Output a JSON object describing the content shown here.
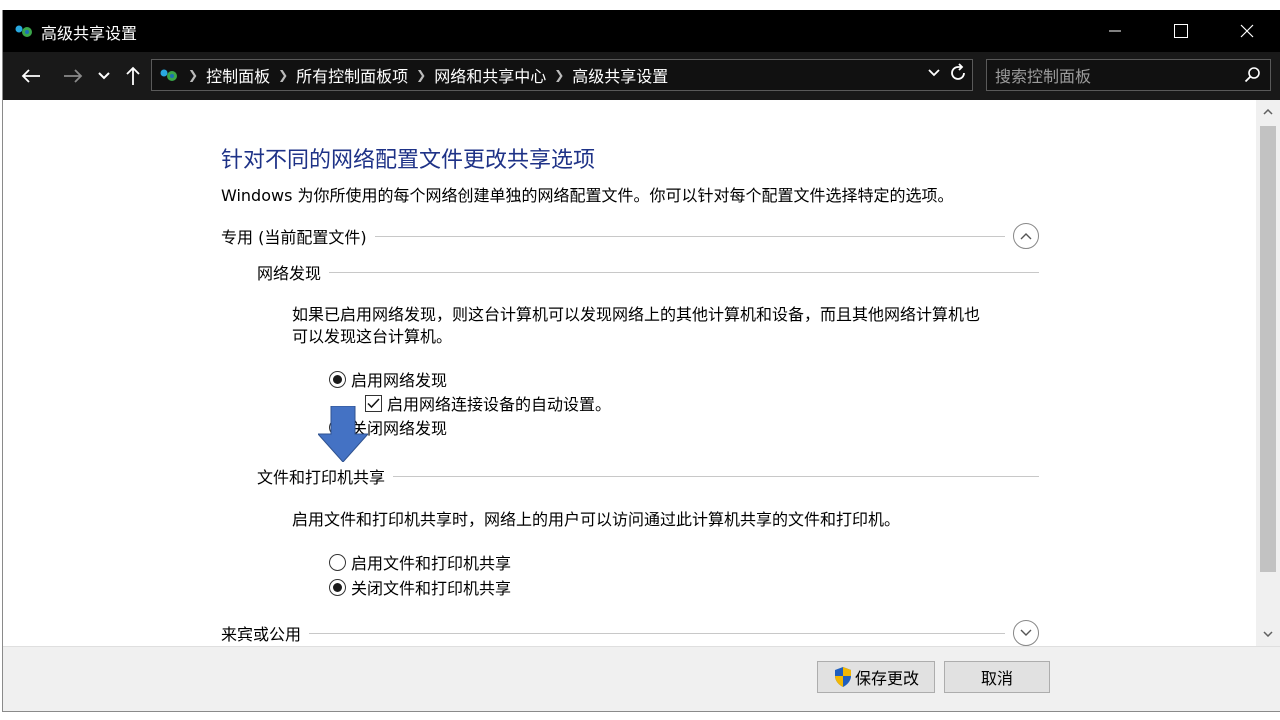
{
  "window": {
    "title": "高级共享设置"
  },
  "addressbar": {
    "breadcrumbs": [
      "控制面板",
      "所有控制面板项",
      "网络和共享中心",
      "高级共享设置"
    ],
    "search_placeholder": "搜索控制面板"
  },
  "main": {
    "heading": "针对不同的网络配置文件更改共享选项",
    "description": "Windows 为你所使用的每个网络创建单独的网络配置文件。你可以针对每个配置文件选择特定的选项。",
    "profile_private": "专用 (当前配置文件)",
    "network_discovery": {
      "label": "网络发现",
      "desc_line1": "如果已启用网络发现，则这台计算机可以发现网络上的其他计算机和设备，而且其他网络计算机也",
      "desc_line2": "可以发现这台计算机。",
      "opt_on": "启用网络发现",
      "opt_auto": "启用网络连接设备的自动设置。",
      "opt_off": "关闭网络发现"
    },
    "file_printer_sharing": {
      "label": "文件和打印机共享",
      "desc": "启用文件和打印机共享时，网络上的用户可以访问通过此计算机共享的文件和打印机。",
      "opt_on": "启用文件和打印机共享",
      "opt_off": "关闭文件和打印机共享"
    },
    "profile_guest": "来宾或公用"
  },
  "footer": {
    "save_label": "保存更改",
    "cancel_label": "取消"
  },
  "colors": {
    "heading": "#1e3287",
    "titlebar": "#000000",
    "addressbar": "#191919",
    "arrow": "#4472c4"
  }
}
